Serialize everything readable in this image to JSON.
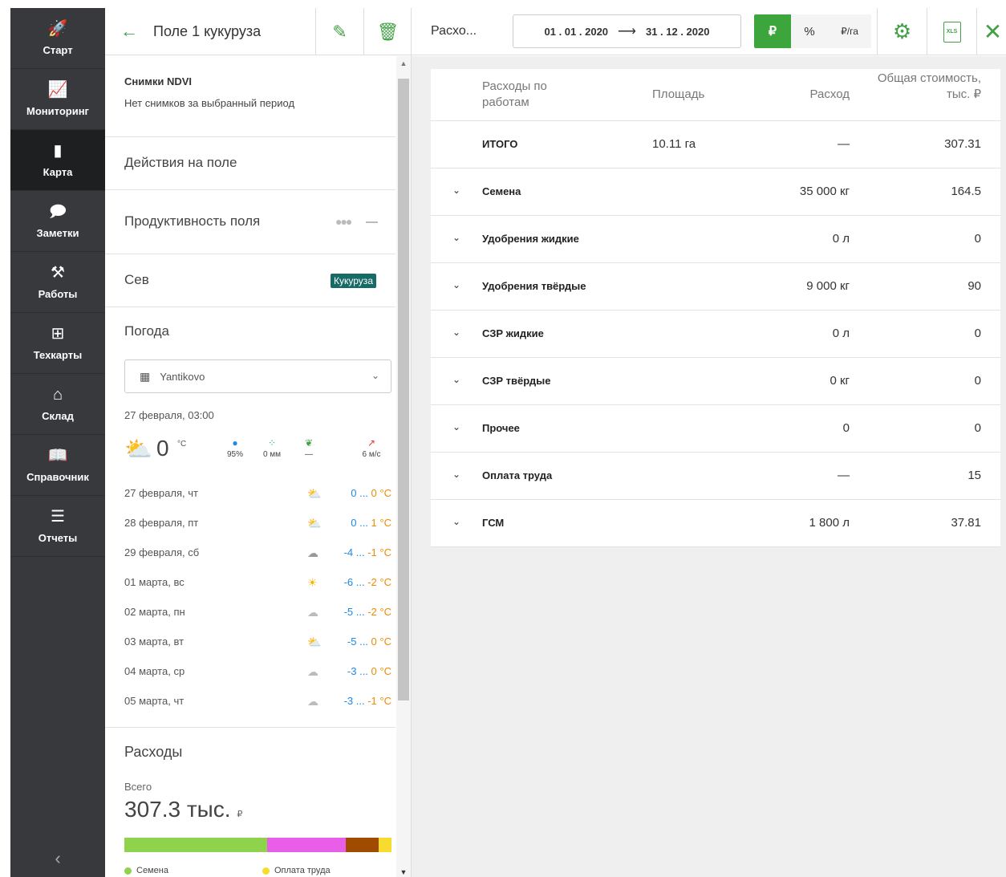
{
  "nav": {
    "items": [
      {
        "label": "Старт",
        "icon": "rocket-icon",
        "glyph": "🚀"
      },
      {
        "label": "Мониторинг",
        "icon": "chart-icon",
        "glyph": "📈"
      },
      {
        "label": "Карта",
        "icon": "map-icon",
        "glyph": "▮"
      },
      {
        "label": "Заметки",
        "icon": "notes-icon",
        "glyph": "🗩"
      },
      {
        "label": "Работы",
        "icon": "works-icon",
        "glyph": "⚒"
      },
      {
        "label": "Техкарты",
        "icon": "techcards-icon",
        "glyph": "⊞"
      },
      {
        "label": "Склад",
        "icon": "warehouse-icon",
        "glyph": "⌂"
      },
      {
        "label": "Справочник",
        "icon": "book-icon",
        "glyph": "📖"
      },
      {
        "label": "Отчеты",
        "icon": "reports-icon",
        "glyph": "☰"
      }
    ],
    "active": "Карта",
    "collapse_glyph": "‹"
  },
  "field": {
    "back_glyph": "←",
    "title": "Поле 1 кукуруза",
    "edit_glyph": "✎",
    "delete_glyph": "🗑",
    "ndvi_title": "Снимки NDVI",
    "ndvi_text": "Нет снимков за выбранный период",
    "actions_title": "Действия на поле",
    "productivity_title": "Продуктивность поля",
    "productivity_value": "—",
    "sowing_title": "Сев",
    "crop": "Кукуруза"
  },
  "weather": {
    "title": "Погода",
    "location": "Yantikovo",
    "datetime": "27 февраля, 03:00",
    "current_temp": "0",
    "current_unit": "°C",
    "humidity": "95%",
    "precip": "0 мм",
    "wind_dir": "—",
    "wind_speed": "6 м/с",
    "forecast": [
      {
        "date": "27 февраля, чт",
        "min": "0",
        "max": "0",
        "icon": "partly-cloudy"
      },
      {
        "date": "28 февраля, пт",
        "min": "0",
        "max": "1",
        "icon": "partly-cloudy"
      },
      {
        "date": "29 февраля, сб",
        "min": "-4",
        "max": "-1",
        "icon": "cloudy"
      },
      {
        "date": "01 марта, вс",
        "min": "-6",
        "max": "-2",
        "icon": "sunny"
      },
      {
        "date": "02 марта, пн",
        "min": "-5",
        "max": "-2",
        "icon": "cloud"
      },
      {
        "date": "03 марта, вт",
        "min": "-5",
        "max": "0",
        "icon": "partly-cloudy"
      },
      {
        "date": "04 марта, ср",
        "min": "-3",
        "max": "0",
        "icon": "cloud"
      },
      {
        "date": "05 марта, чт",
        "min": "-3",
        "max": "-1",
        "icon": "cloud"
      }
    ],
    "sep": "...",
    "deg": "°C"
  },
  "expenses_summary": {
    "title": "Расходы",
    "total_label": "Всего",
    "total_value": "307.3 тыс.",
    "total_currency": "₽",
    "bar": [
      {
        "name": "Семена",
        "share": 0.535,
        "color": "#8fd24c"
      },
      {
        "name": "Удобрения твёрдые",
        "share": 0.293,
        "color": "#e85ee8"
      },
      {
        "name": "ГСМ",
        "share": 0.123,
        "color": "#a04c00"
      },
      {
        "name": "Оплата труда",
        "share": 0.049,
        "color": "#f7dc2f"
      }
    ],
    "legend": [
      "Семена",
      "Оплата труда"
    ]
  },
  "toolbar": {
    "title": "Расхо...",
    "date_from": "01 . 01 . 2020",
    "date_arrow": "⟶",
    "date_to": "31 . 12 . 2020",
    "unit_rub": "₽",
    "unit_pct": "%",
    "unit_rub_ha": "₽/га",
    "xls_label": "XLS",
    "close_glyph": "✕",
    "settings_glyph": "⚙",
    "colors": {
      "accent": "#3ca53c"
    }
  },
  "table": {
    "headers": {
      "name": "Расходы по работам",
      "area": "Площадь",
      "amount": "Расход",
      "cost": "Общая стоимость, тыс. ₽"
    },
    "total": {
      "name": "ИТОГО",
      "area": "10.11 га",
      "amount": "—",
      "cost": "307.31"
    },
    "rows": [
      {
        "name": "Семена",
        "amount": "35 000 кг",
        "cost": "164.5"
      },
      {
        "name": "Удобрения жидкие",
        "amount": "0 л",
        "cost": "0"
      },
      {
        "name": "Удобрения твёрдые",
        "amount": "9 000 кг",
        "cost": "90"
      },
      {
        "name": "СЗР жидкие",
        "amount": "0 л",
        "cost": "0"
      },
      {
        "name": "СЗР твёрдые",
        "amount": "0 кг",
        "cost": "0"
      },
      {
        "name": "Прочее",
        "amount": "0",
        "cost": "0"
      },
      {
        "name": "Оплата труда",
        "amount": "—",
        "cost": "15"
      },
      {
        "name": "ГСМ",
        "amount": "1 800 л",
        "cost": "37.81"
      }
    ]
  }
}
